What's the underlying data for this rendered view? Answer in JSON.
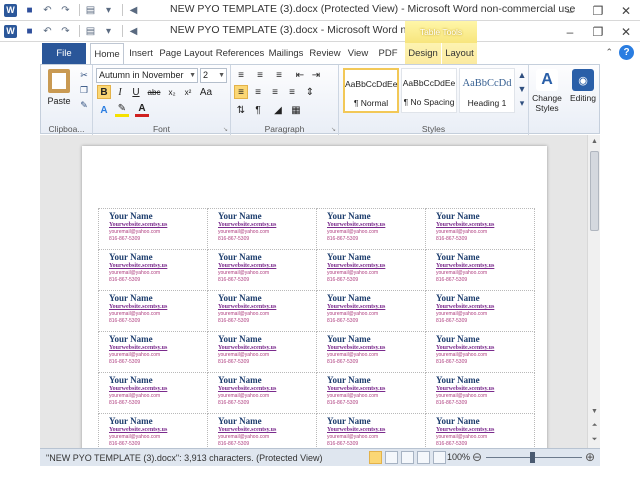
{
  "window_back": {
    "title": "NEW PYO TEMPLATE (3).docx (Protected View) - Microsoft Word non-commercial use"
  },
  "window_front": {
    "title": "NEW PYO TEMPLATE (3).docx - Microsoft Word non-com..."
  },
  "contextual": {
    "label": "Table Tools"
  },
  "tabs": {
    "file": "File",
    "home": "Home",
    "insert": "Insert",
    "page_layout": "Page Layout",
    "references": "References",
    "mailings": "Mailings",
    "review": "Review",
    "view": "View",
    "pdf": "PDF",
    "design": "Design",
    "layout": "Layout"
  },
  "ribbon": {
    "clipboard": {
      "label": "Clipboa...",
      "paste": "Paste"
    },
    "font": {
      "label": "Font",
      "name": "Autumn in November",
      "size": "2"
    },
    "paragraph": {
      "label": "Paragraph"
    },
    "styles": {
      "label": "Styles",
      "items": [
        {
          "preview": "AaBbCcDdEe",
          "name": "¶ Normal"
        },
        {
          "preview": "AaBbCcDdEe",
          "name": "¶ No Spacing"
        },
        {
          "preview": "AaBbCcDd",
          "name": "Heading 1"
        }
      ],
      "change_styles": "Change Styles"
    },
    "editing": {
      "label": "Editing"
    }
  },
  "document": {
    "label_template": {
      "name": "Your Name",
      "website": "Yourwebsite.scentsy.us",
      "email": "youremail@yahoo.com",
      "phone": "816-867-5309"
    },
    "rows": 6,
    "cols": 4
  },
  "status": {
    "text": "\"NEW PYO TEMPLATE (3).docx\": 3,913 characters.  (Protected View)",
    "zoom": "100%"
  },
  "colors": {
    "file_tab": "#2a5699",
    "accent_yellow": "#fbd775",
    "name_text": "#1e3e6e",
    "website_text": "#7a2a8c",
    "contact_text": "#b04080"
  }
}
